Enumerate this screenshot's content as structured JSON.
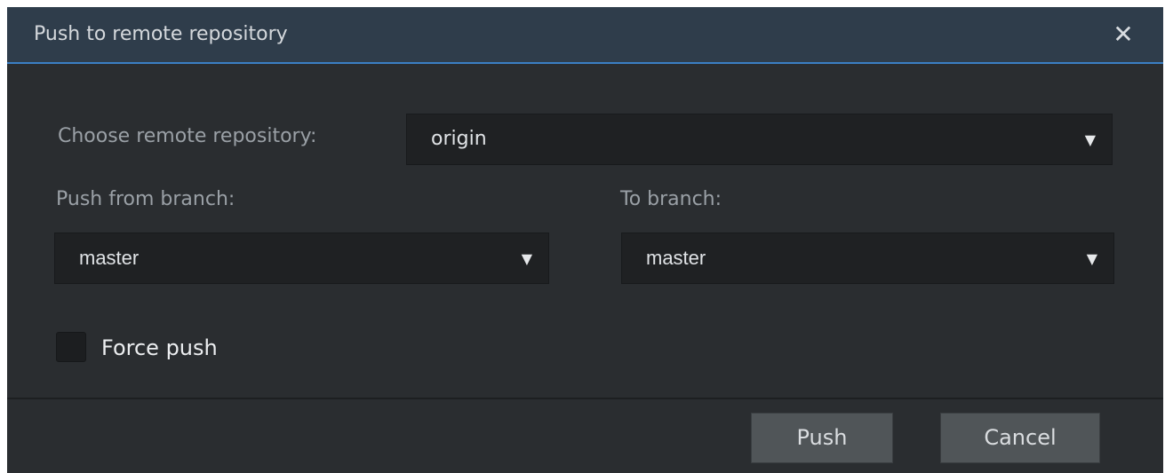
{
  "dialog": {
    "title": "Push to remote repository",
    "close_glyph": "✕"
  },
  "remote": {
    "label": "Choose remote repository:",
    "selected": "origin",
    "arrow": "▼"
  },
  "from_branch": {
    "label": "Push from branch:",
    "selected": "master",
    "arrow": "▼"
  },
  "to_branch": {
    "label": "To branch:",
    "selected": "master",
    "arrow": "▼"
  },
  "force_push": {
    "label": "Force push",
    "checked": false
  },
  "buttons": {
    "push": "Push",
    "cancel": "Cancel"
  },
  "colors": {
    "titlebar": "#2f3d4b",
    "accent": "#3b7fc4",
    "body": "#2a2d30",
    "field": "#1f2123",
    "button": "#505558"
  },
  "icons": {
    "close": "close-icon",
    "dropdown": "chevron-down-icon"
  }
}
